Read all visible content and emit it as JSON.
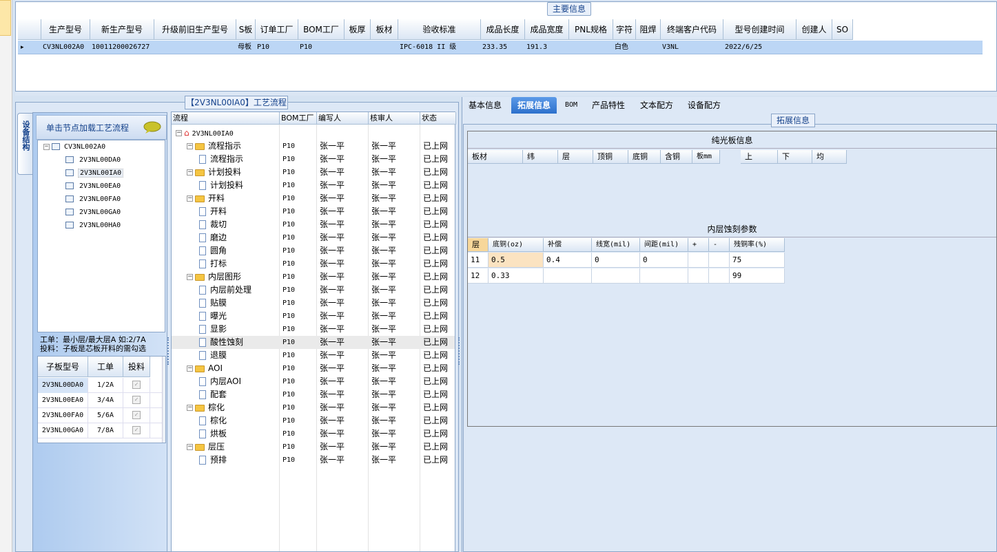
{
  "top": {
    "legend": "主要信息",
    "columns": [
      "生产型号",
      "新生产型号",
      "升级前旧生产型号",
      "S板",
      "订单工厂",
      "BOM工厂",
      "板厚",
      "板材",
      "验收标准",
      "成品长度",
      "成品宽度",
      "PNL规格",
      "字符",
      "阻焊",
      "终端客户代码",
      "型号创建时间",
      "创建人",
      "SO"
    ],
    "row": [
      "CV3NL002A0",
      "10011200026727",
      "",
      "母板",
      "P10",
      "P10",
      "",
      "",
      "IPC-6018 II 级",
      "233.35",
      "191.3",
      "",
      "白色",
      "",
      "V3NL",
      "2022/6/25",
      "",
      ""
    ],
    "row_indicator": "▸"
  },
  "flow": {
    "legend": "【2V3NL00IA0】工艺流程",
    "side_tab": "设备结构",
    "load_label": "单击节点加载工艺流程",
    "tree_root": "CV3NL002A0",
    "tree_children": [
      "2V3NL00DA0",
      "2V3NL00IA0",
      "2V3NL00EA0",
      "2V3NL00FA0",
      "2V3NL00GA0",
      "2V3NL00HA0"
    ],
    "note_line1": "工单：最小层/最大层A 如:2/7A",
    "note_line2": "投料：子板是芯板开料的需勾选",
    "sub_columns": [
      "子板型号",
      "工单",
      "投料"
    ],
    "sub_rows": [
      {
        "model": "2V3NL00DA0",
        "order": "1/2A",
        "checked": true
      },
      {
        "model": "2V3NL00EA0",
        "order": "3/4A",
        "checked": true
      },
      {
        "model": "2V3NL00FA0",
        "order": "5/6A",
        "checked": true
      },
      {
        "model": "2V3NL00GA0",
        "order": "7/8A",
        "checked": true
      }
    ],
    "grid_columns": [
      "流程",
      "BOM工厂",
      "编写人",
      "核审人",
      "状态"
    ],
    "root_node": "2V3NL00IA0",
    "steps": [
      {
        "name": "流程指示",
        "folder": true
      },
      {
        "name": "流程指示",
        "folder": false
      },
      {
        "name": "计划投料",
        "folder": true
      },
      {
        "name": "计划投料",
        "folder": false
      },
      {
        "name": "开料",
        "folder": true
      },
      {
        "name": "开料",
        "folder": false
      },
      {
        "name": "裁切",
        "folder": false
      },
      {
        "name": "磨边",
        "folder": false
      },
      {
        "name": "圆角",
        "folder": false
      },
      {
        "name": "打标",
        "folder": false
      },
      {
        "name": "内层图形",
        "folder": true
      },
      {
        "name": "内层前处理",
        "folder": false
      },
      {
        "name": "贴膜",
        "folder": false
      },
      {
        "name": "曝光",
        "folder": false
      },
      {
        "name": "显影",
        "folder": false
      },
      {
        "name": "酸性蚀刻",
        "folder": false
      },
      {
        "name": "退膜",
        "folder": false
      },
      {
        "name": "AOI",
        "folder": true
      },
      {
        "name": "内层AOI",
        "folder": false
      },
      {
        "name": "配套",
        "folder": false
      },
      {
        "name": "棕化",
        "folder": true
      },
      {
        "name": "棕化",
        "folder": false
      },
      {
        "name": "烘板",
        "folder": false
      },
      {
        "name": "层压",
        "folder": true
      },
      {
        "name": "预排",
        "folder": false
      }
    ],
    "bom_factory": "P10",
    "writer": "张一平",
    "reviewer": "张一平",
    "status": "已上网"
  },
  "right": {
    "tabs": [
      "基本信息",
      "拓展信息",
      "BOM",
      "产品特性",
      "文本配方",
      "设备配方"
    ],
    "active_tab": "拓展信息",
    "ext_legend": "拓展信息",
    "bare_title": "纯光板信息",
    "bare_columns": [
      "板材",
      "纬",
      "层",
      "顶铜",
      "底铜",
      "含铜",
      "板mm",
      "上",
      "下",
      "均"
    ],
    "inner_title": "内层蚀刻参数",
    "inner_columns": [
      "层",
      "底铜(oz)",
      "补偿",
      "线宽(mil)",
      "间距(mil)",
      "+",
      "-",
      "残铜率(%)"
    ],
    "inner_rows": [
      [
        "11",
        "0.5",
        "0.4",
        "0",
        "0",
        "",
        "",
        "75"
      ],
      [
        "12",
        "0.33",
        "",
        "",
        "",
        "",
        "",
        "99"
      ]
    ]
  }
}
